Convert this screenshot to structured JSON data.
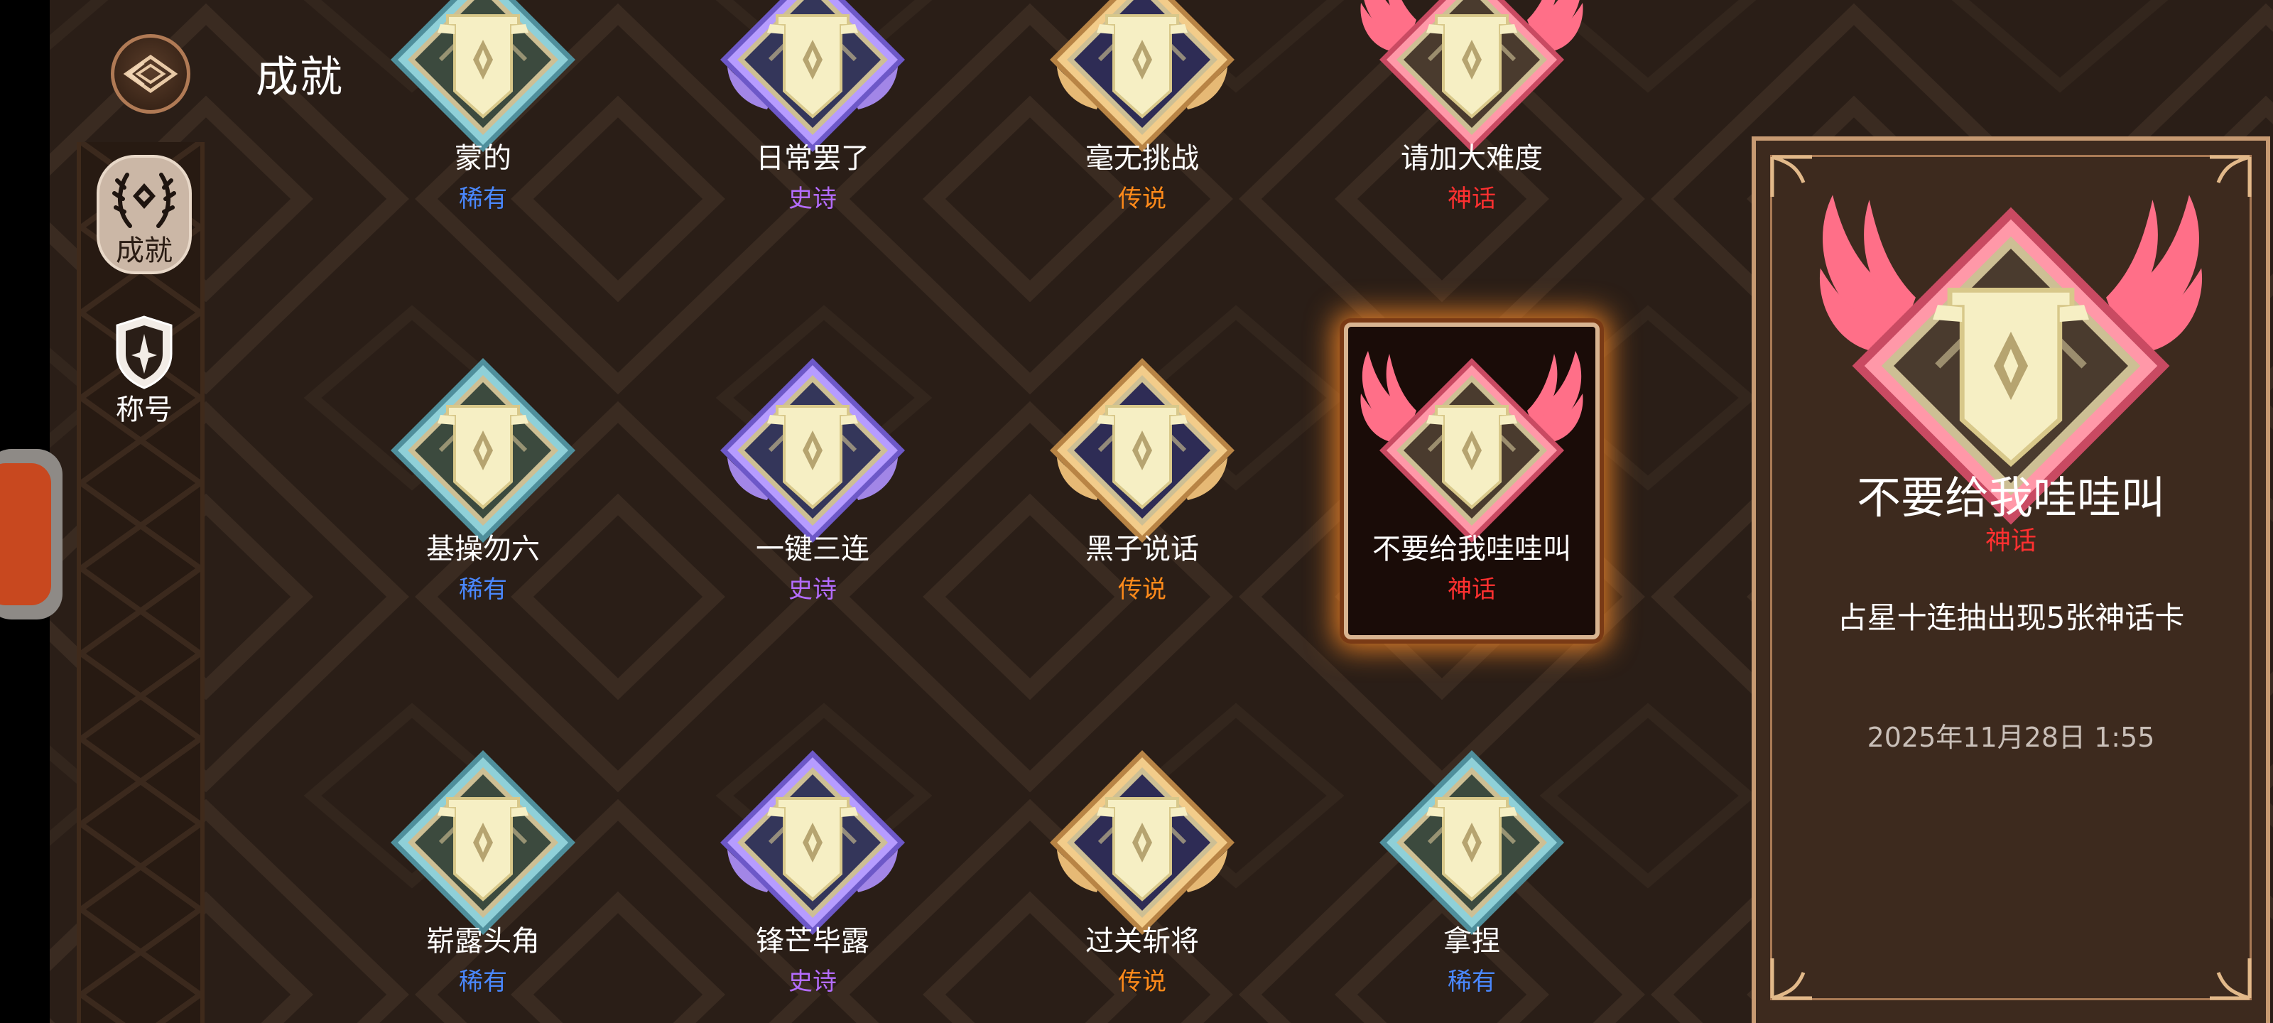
{
  "header": {
    "title": "成就",
    "back_icon": "back-diamond-icon"
  },
  "sidebar": {
    "tabs": [
      {
        "label": "成就",
        "icon": "laurel-icon",
        "active": true
      },
      {
        "label": "称号",
        "icon": "shield-icon",
        "active": false
      }
    ]
  },
  "rarity_colors": {
    "稀有": "#4a88ff",
    "史诗": "#b46cff",
    "传说": "#ff8a1a",
    "神话": "#ff3030"
  },
  "achievements": [
    {
      "name": "蒙的",
      "rarity": "稀有",
      "tier": "rare",
      "selected": false
    },
    {
      "name": "日常罢了",
      "rarity": "史诗",
      "tier": "epic",
      "selected": false
    },
    {
      "name": "毫无挑战",
      "rarity": "传说",
      "tier": "legend",
      "selected": false
    },
    {
      "name": "请加大难度",
      "rarity": "神话",
      "tier": "myth",
      "selected": false
    },
    {
      "name": "基操勿六",
      "rarity": "稀有",
      "tier": "rare",
      "selected": false
    },
    {
      "name": "一键三连",
      "rarity": "史诗",
      "tier": "epic",
      "selected": false
    },
    {
      "name": "黑子说话",
      "rarity": "传说",
      "tier": "legend",
      "selected": false
    },
    {
      "name": "不要给我哇哇叫",
      "rarity": "神话",
      "tier": "myth",
      "selected": true
    },
    {
      "name": "崭露头角",
      "rarity": "稀有",
      "tier": "rare",
      "selected": false
    },
    {
      "name": "锋芒毕露",
      "rarity": "史诗",
      "tier": "epic",
      "selected": false
    },
    {
      "name": "过关斩将",
      "rarity": "传说",
      "tier": "legend",
      "selected": false
    },
    {
      "name": "拿捏",
      "rarity": "稀有",
      "tier": "rare",
      "selected": false
    }
  ],
  "detail": {
    "name": "不要给我哇哇叫",
    "rarity": "神话",
    "description": "占星十连抽出现5张神话卡",
    "date": "2025年11月28日 1:55"
  },
  "colors": {
    "background": "#2a1e17",
    "panel": "#3d2a1e",
    "panel_border": "#c79a72",
    "selected_glow": "#ff8c28"
  }
}
